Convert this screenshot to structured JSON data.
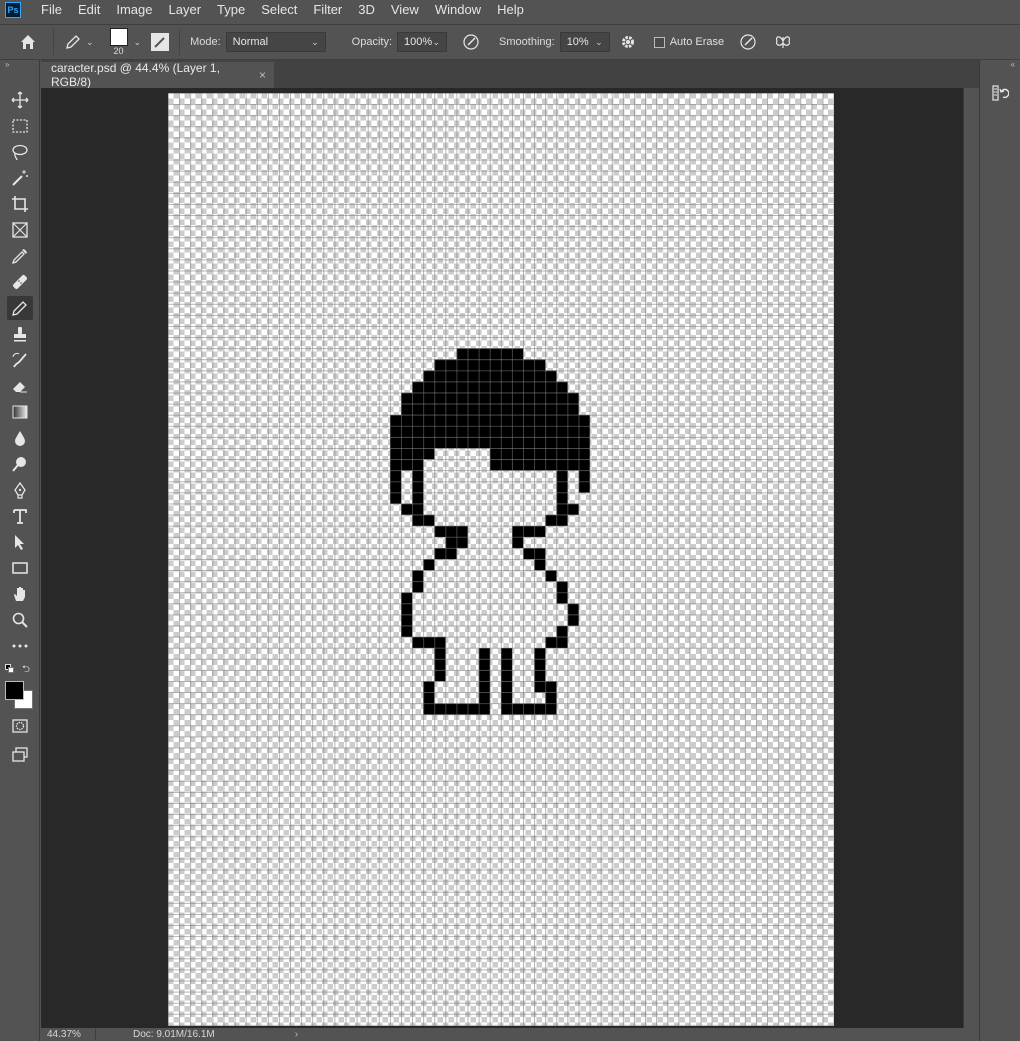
{
  "app": {
    "logo": "Ps"
  },
  "menu": [
    "File",
    "Edit",
    "Image",
    "Layer",
    "Type",
    "Select",
    "Filter",
    "3D",
    "View",
    "Window",
    "Help"
  ],
  "options": {
    "brush_size": "20",
    "mode_label": "Mode:",
    "mode_value": "Normal",
    "opacity_label": "Opacity:",
    "opacity_value": "100%",
    "smoothing_label": "Smoothing:",
    "smoothing_value": "10%",
    "auto_erase_label": "Auto Erase"
  },
  "document": {
    "tab_title": "caracter.psd @ 44.4% (Layer 1, RGB/8)",
    "close_glyph": "×"
  },
  "status": {
    "zoom": "44.37%",
    "doc_info": "Doc: 9.01M/16.1M",
    "arrow": "›"
  },
  "colors": {
    "foreground": "#000000",
    "background": "#ffffff"
  },
  "toolbar": {
    "active_tool": "pencil-tool"
  }
}
